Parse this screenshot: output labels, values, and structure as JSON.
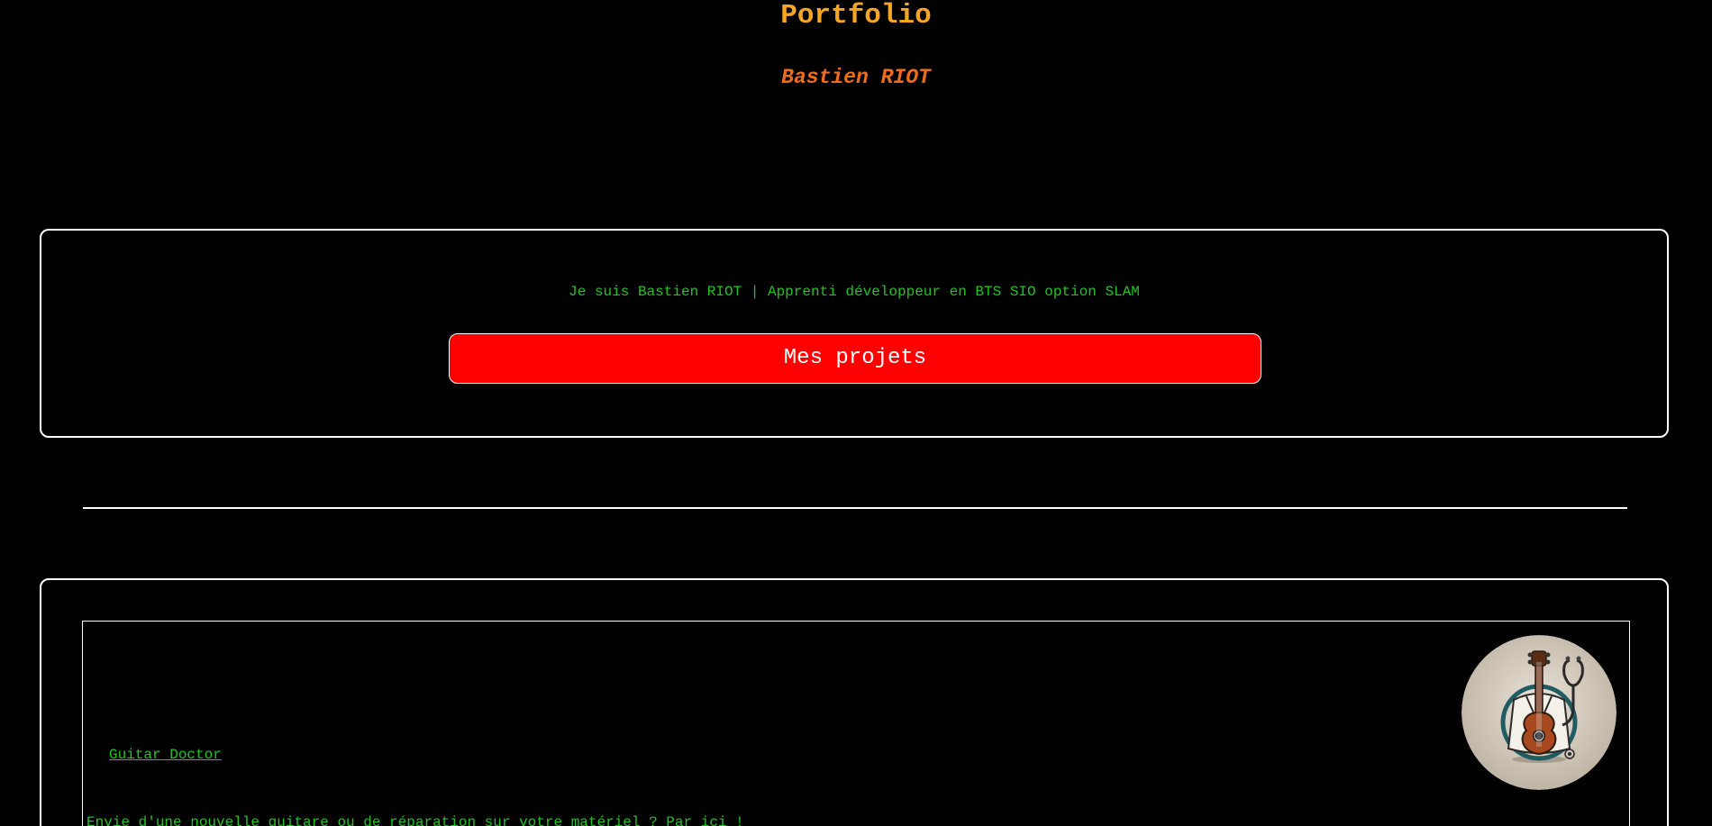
{
  "header": {
    "title": "Portfolio",
    "subtitle": "Bastien RIOT"
  },
  "intro": {
    "text": "Je suis Bastien RIOT | Apprenti développeur en BTS SIO option SLAM",
    "button_label": "Mes projets"
  },
  "projects": [
    {
      "name": "Guitar Doctor",
      "description": "Envie d'une nouvelle guitare ou de réparation sur votre matériel ? Par ici !",
      "logo_icon": "guitar-doctor-logo-icon"
    }
  ],
  "colors": {
    "background": "#000000",
    "title": "#f5a623",
    "subtitle": "#ef6d1a",
    "body_text": "#22c322",
    "button": "#ff0000",
    "border": "#ffffff"
  }
}
